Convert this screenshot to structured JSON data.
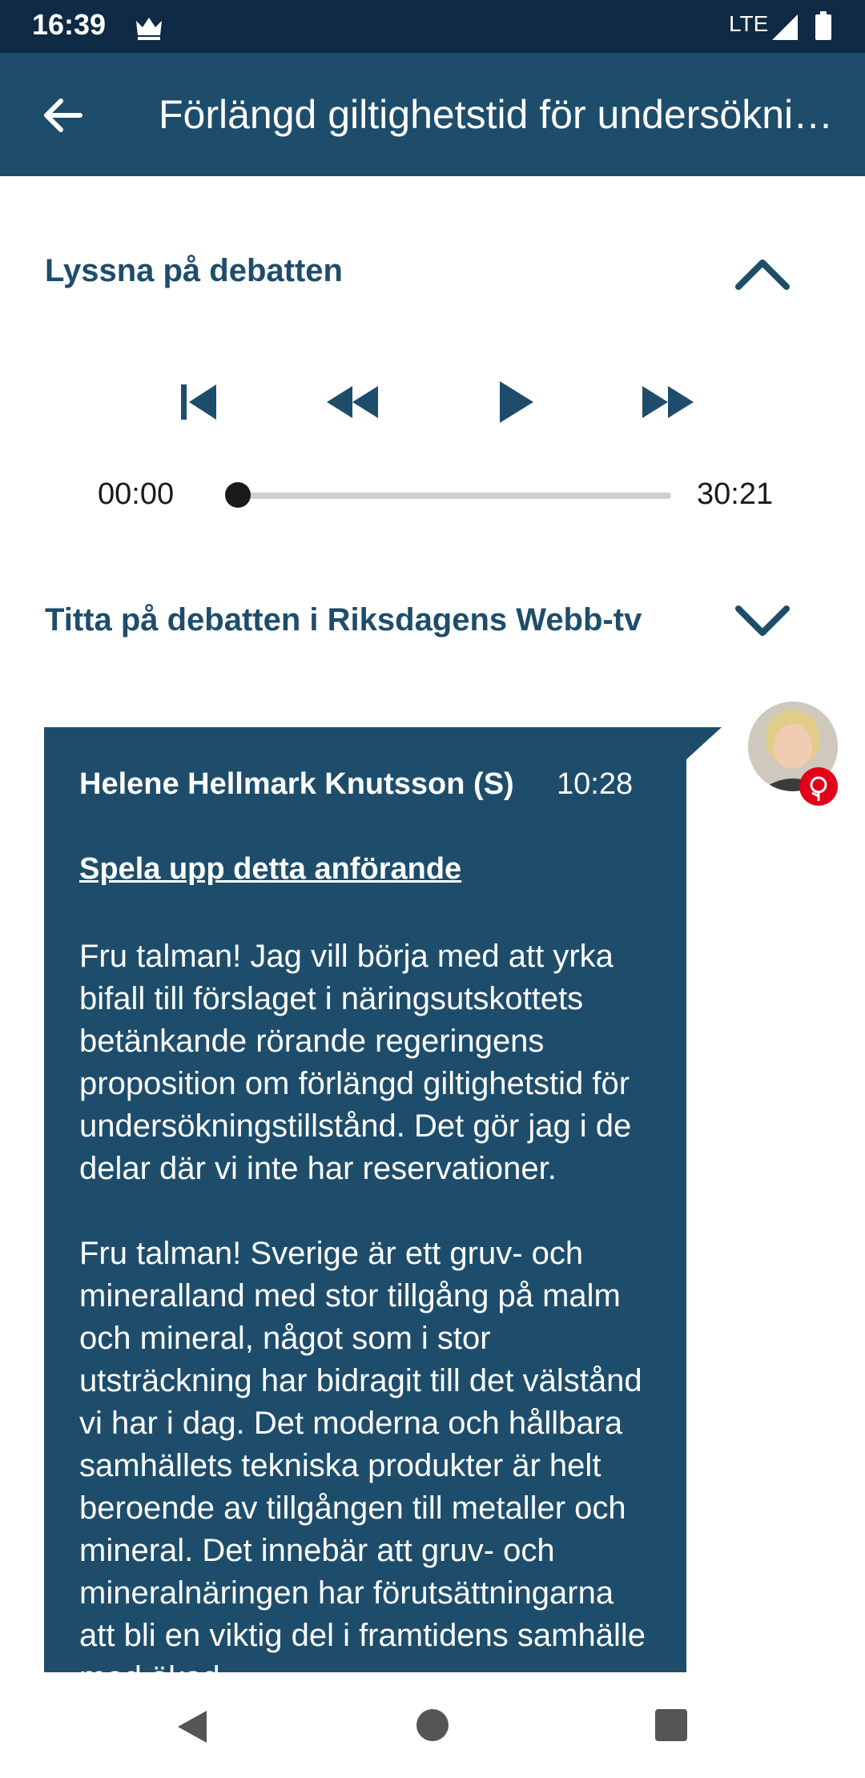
{
  "status_bar": {
    "time": "16:39",
    "network": "LTE"
  },
  "app_bar": {
    "title": "Förlängd giltighetstid för undersökningstillstånd"
  },
  "audio_section": {
    "heading": "Lyssna på debatten"
  },
  "player": {
    "current_time": "00:00",
    "total_time": "30:21",
    "progress": 0
  },
  "video_section": {
    "heading": "Titta på debatten i Riksdagens Webb-tv"
  },
  "speech": {
    "speaker": "Helene Hellmark Knutsson (S)",
    "time": "10:28",
    "play_link": "Spela upp detta anförande",
    "paragraphs": [
      "Fru talman! Jag vill börja med att yrka bifall till förslaget i näringsutskottets betänkande rörande regeringens proposition om förlängd giltighetstid för undersökningstillstånd. Det gör jag i de delar där vi inte har reservationer.",
      "Fru talman! Sverige är ett gruv- och mineralland med stor tillgång på malm och mineral, något som i stor utsträckning har bidragit till det välstånd vi har i dag. Det moderna och hållbara samhällets tekniska produkter är helt beroende av tillgången till metaller och mineral. Det innebär att gruv- och mineralnäringen har förutsättningarna att bli en viktig del i framtidens samhälle med ökad"
    ]
  },
  "colors": {
    "primary": "#1e4d6b",
    "status_bar": "#0e2a44",
    "party_red": "#e2001a"
  }
}
